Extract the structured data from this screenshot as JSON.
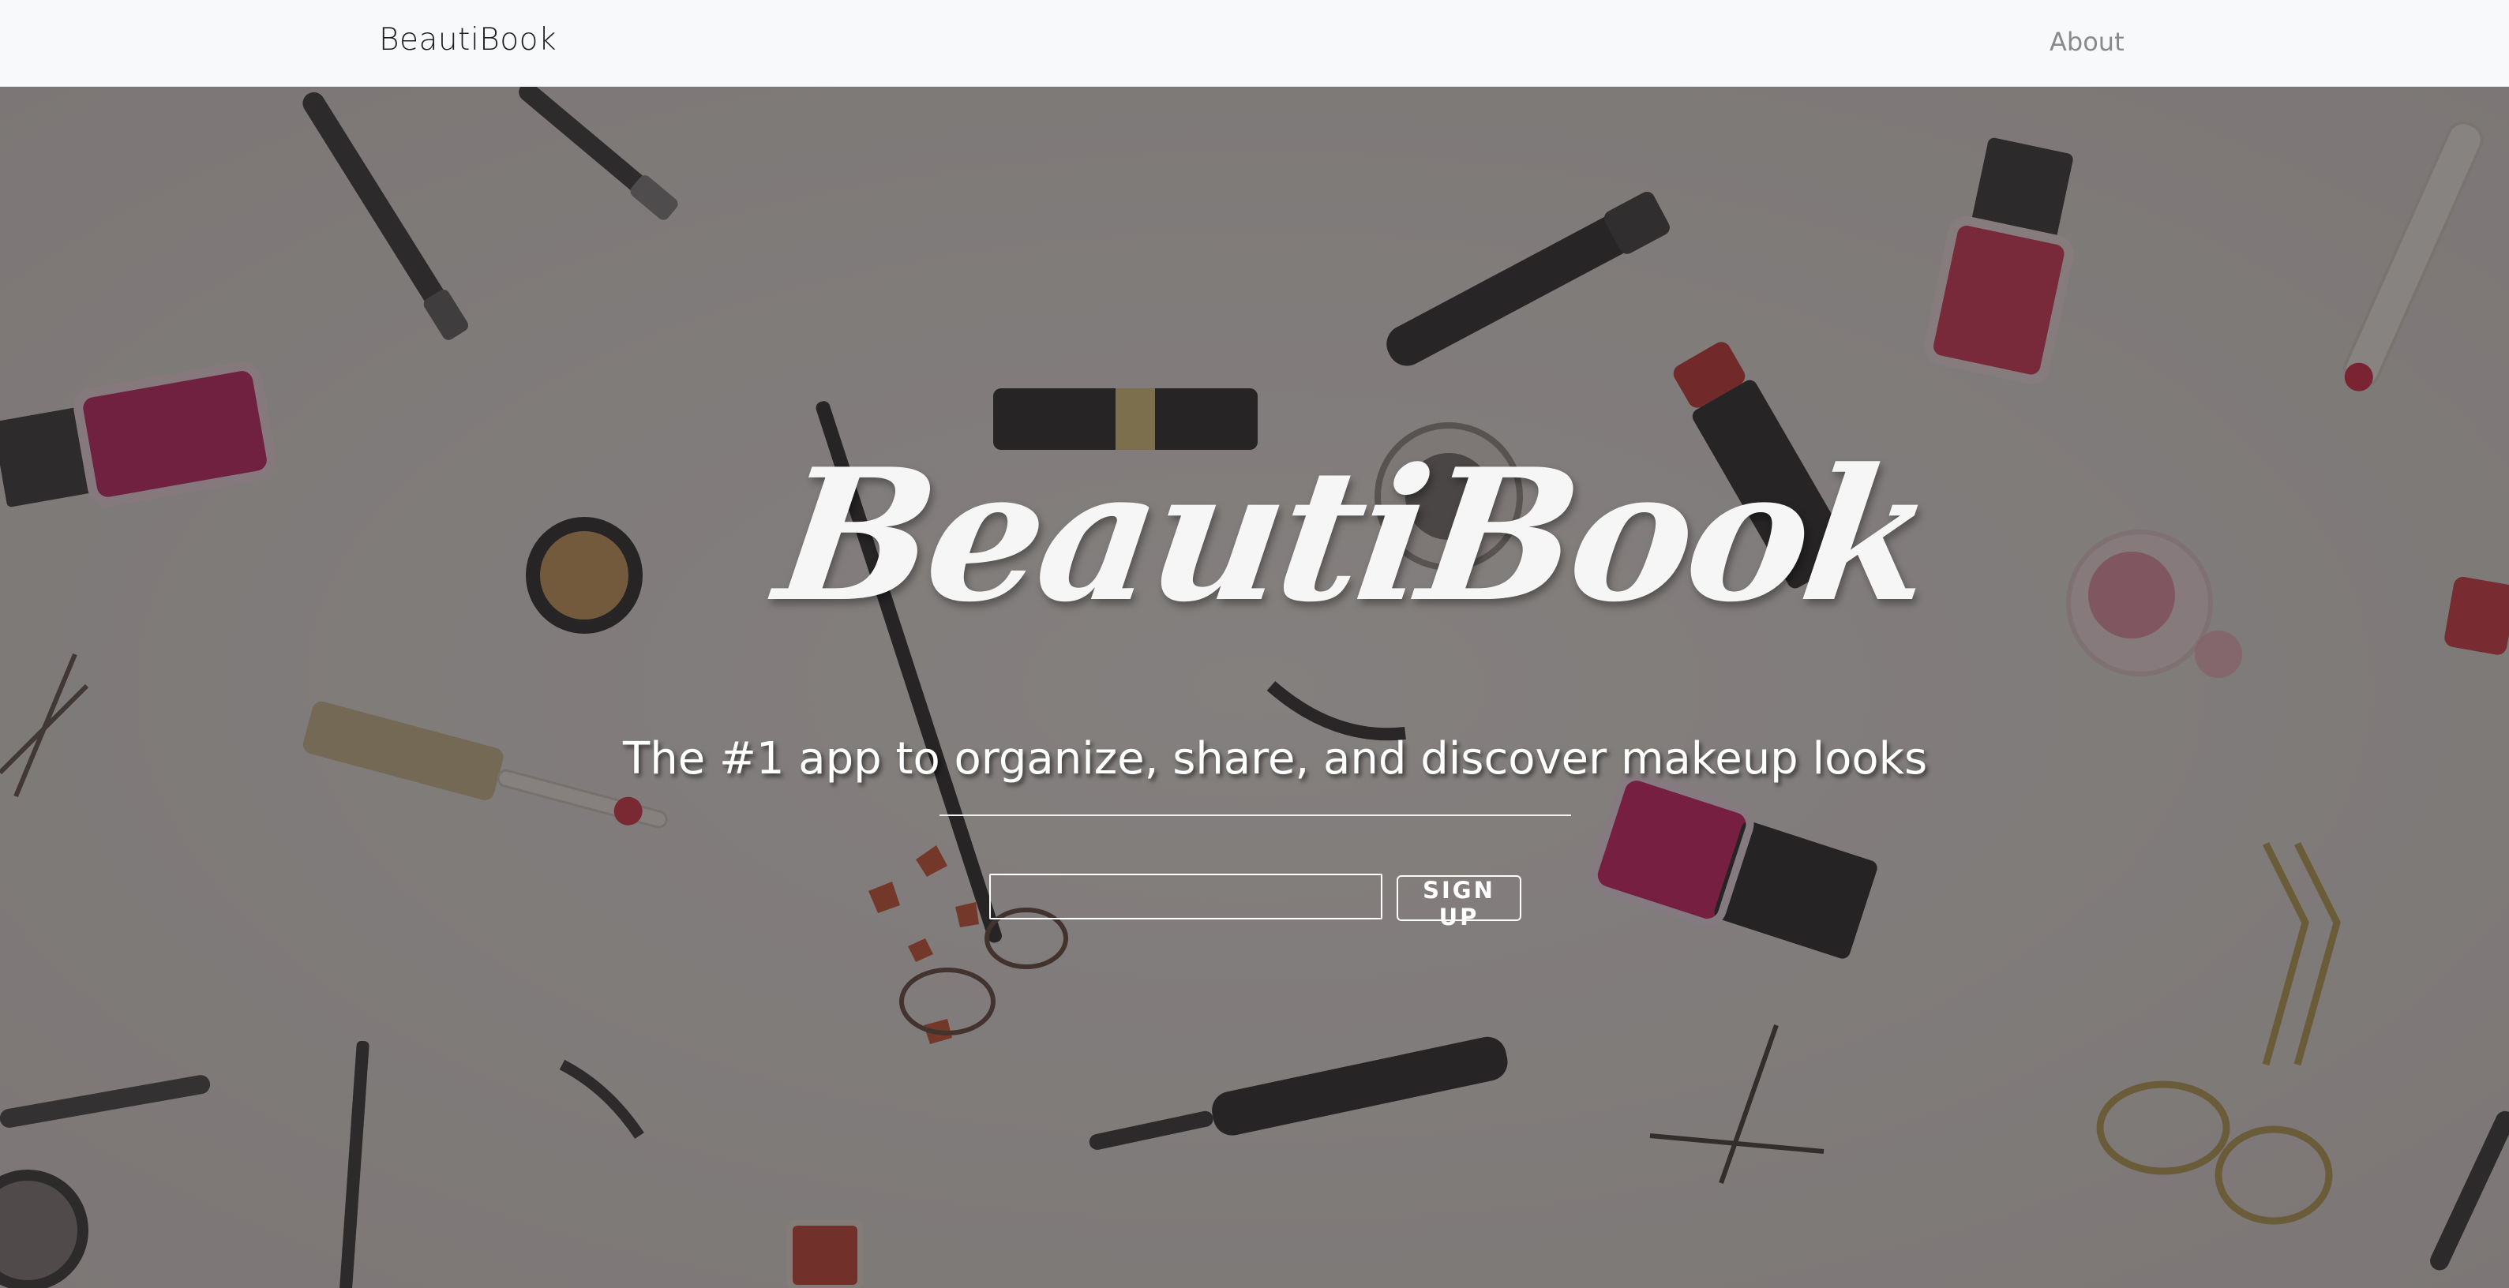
{
  "navbar": {
    "brand": "BeautiBook",
    "links": [
      "About"
    ]
  },
  "hero": {
    "title": "BeautiBook",
    "tagline": "The #1 app to organize, share, and discover makeup looks",
    "signup": {
      "email_value": "",
      "button_label": "SIGN UP"
    }
  },
  "colors": {
    "navbar_bg": "#f8f9fa",
    "hero_text": "#ffffff",
    "nail_polish": "#c2185b",
    "lipstick": "#c62828"
  }
}
